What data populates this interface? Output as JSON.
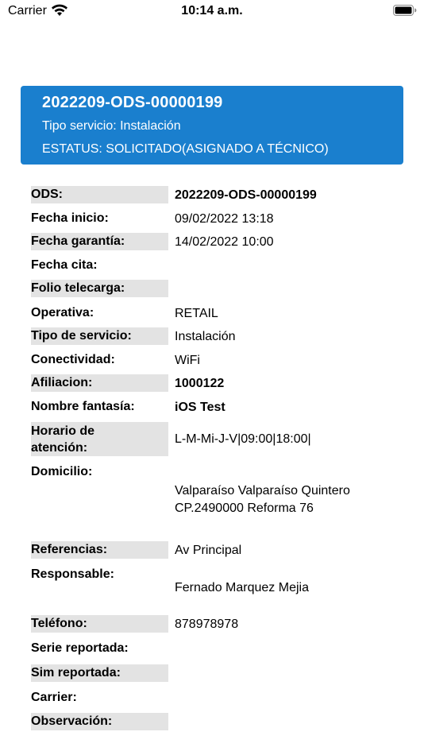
{
  "status_bar": {
    "carrier": "Carrier",
    "time": "10:14 a.m."
  },
  "header": {
    "title": "2022209-ODS-00000199",
    "service_type": "Tipo servicio: Instalación",
    "status": "ESTATUS: SOLICITADO(ASIGNADO A TÉCNICO)",
    "background_color": "#1a7fce"
  },
  "details": {
    "ods": {
      "label": "ODS:",
      "value": "2022209-ODS-00000199"
    },
    "fecha_inicio": {
      "label": "Fecha inicio:",
      "value": "09/02/2022 13:18"
    },
    "fecha_garantia": {
      "label": "Fecha garantía:",
      "value": "14/02/2022 10:00"
    },
    "fecha_cita": {
      "label": "Fecha cita:",
      "value": ""
    },
    "folio_telecarga": {
      "label": "Folio telecarga:",
      "value": ""
    },
    "operativa": {
      "label": "Operativa:",
      "value": "RETAIL"
    },
    "tipo_servicio": {
      "label": "Tipo de servicio:",
      "value": "Instalación"
    },
    "conectividad": {
      "label": "Conectividad:",
      "value": "WiFi"
    },
    "afiliacion": {
      "label": "Afiliacion:",
      "value": "1000122"
    },
    "nombre_fantasia": {
      "label": "Nombre fantasía:",
      "value": "iOS Test"
    },
    "horario_atencion": {
      "label_line1": "Horario de",
      "label_line2": "atención:",
      "value": "L-M-Mi-J-V|09:00|18:00|"
    },
    "domicilio": {
      "label": "Domicilio:",
      "value_line1": "Valparaíso Valparaíso Quintero",
      "value_line2": "CP.2490000 Reforma 76"
    },
    "referencias": {
      "label": "Referencias:",
      "value": "Av Principal"
    },
    "responsable": {
      "label": "Responsable:",
      "value": "Fernado Marquez Mejia"
    },
    "telefono": {
      "label": "Teléfono:",
      "value": "878978978"
    },
    "serie_reportada": {
      "label": "Serie reportada:",
      "value": ""
    },
    "sim_reportada": {
      "label": "Sim reportada:",
      "value": ""
    },
    "carrier": {
      "label": "Carrier:",
      "value": ""
    },
    "observacion": {
      "label": "Observación:",
      "value": ""
    }
  }
}
